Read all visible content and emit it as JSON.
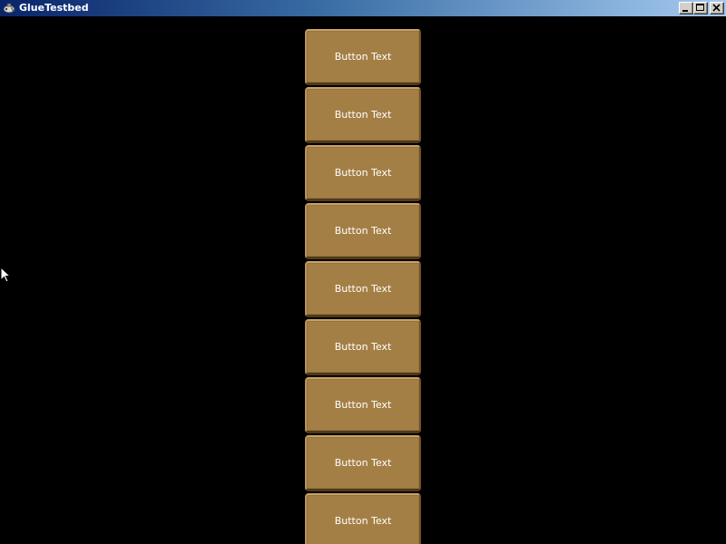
{
  "window": {
    "title": "GlueTestbed",
    "icon": "gamepad-icon",
    "controls": [
      "minimize-icon",
      "maximize-icon",
      "close-icon"
    ]
  },
  "buttons": [
    {
      "label": "Button Text"
    },
    {
      "label": "Button Text"
    },
    {
      "label": "Button Text"
    },
    {
      "label": "Button Text"
    },
    {
      "label": "Button Text"
    },
    {
      "label": "Button Text"
    },
    {
      "label": "Button Text"
    },
    {
      "label": "Button Text"
    },
    {
      "label": "Button Text"
    }
  ],
  "colors": {
    "background": "#000000",
    "button_fill": "#a47f45",
    "button_text": "#ffffff",
    "titlebar_start": "#0a246a",
    "titlebar_end": "#a6caf0"
  }
}
